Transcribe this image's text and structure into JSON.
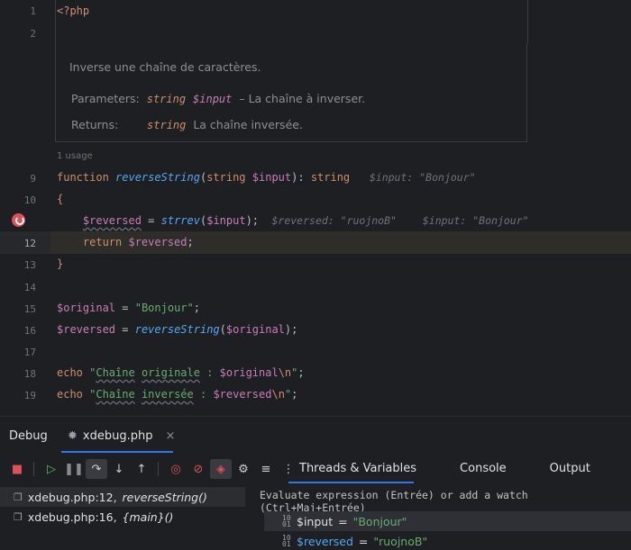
{
  "editor": {
    "lines": [
      {
        "num": "1",
        "text": "<?php"
      },
      {
        "num": "2",
        "text": ""
      },
      {
        "num": "9",
        "text": "function reverseString(string $input): string"
      },
      {
        "num": "10",
        "text": "{"
      },
      {
        "num": "",
        "text": "$reversed = strrev($input);"
      },
      {
        "num": "12",
        "text": "return $reversed;"
      },
      {
        "num": "13",
        "text": "}"
      },
      {
        "num": "14",
        "text": ""
      },
      {
        "num": "15",
        "text": "$original = \"Bonjour\";"
      },
      {
        "num": "16",
        "text": "$reversed = reverseString($original);"
      },
      {
        "num": "17",
        "text": ""
      },
      {
        "num": "18",
        "text": "echo \"Chaîne originale : $original\\n\";"
      },
      {
        "num": "19",
        "text": "echo \"Chaîne inversée : $reversed\\n\";"
      }
    ],
    "doc": {
      "description": "Inverse une chaîne de caractères.",
      "params_label": "Parameters:",
      "params_type": "string",
      "params_var": "$input",
      "params_desc": "– La chaîne à inverser.",
      "returns_label": "Returns:",
      "returns_type": "string",
      "returns_desc": "La chaîne inversée."
    },
    "usage": "1 usage",
    "hints": {
      "line9": "$input: \"Bonjour\"",
      "line11a": "$reversed: \"ruojnoB\"",
      "line11b": "$input: \"Bonjour\""
    }
  },
  "debug": {
    "title": "Debug",
    "session_tab": "xdebug.php",
    "right_tabs": [
      "Threads & Variables",
      "Console",
      "Output"
    ],
    "frames": [
      {
        "file": "xdebug.php:12,",
        "func": "reverseString()"
      },
      {
        "file": "xdebug.php:16,",
        "func": "{main}()"
      }
    ],
    "watch_hint": "Evaluate expression (Entrée) or add a watch (Ctrl+Maj+Entrée)",
    "variables": [
      {
        "name": "$input",
        "value": "\"Bonjour\""
      },
      {
        "name": "$reversed",
        "value": "\"ruojnoB\""
      }
    ]
  },
  "colors": {
    "accent": "#3574f0",
    "breakpoint": "#e0505a",
    "string": "#6aab73",
    "keyword": "#cf8e6d",
    "variable": "#c77dbb",
    "function": "#56a8f5"
  }
}
